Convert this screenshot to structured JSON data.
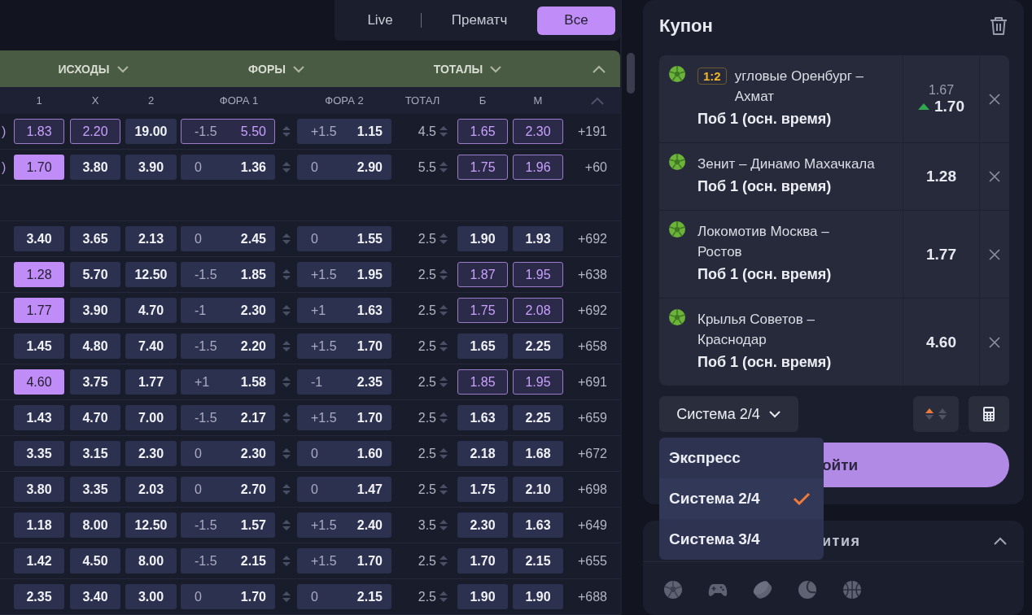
{
  "mode_tabs": [
    {
      "label": "Live",
      "selected": false
    },
    {
      "label": "Прематч",
      "selected": false
    },
    {
      "label": "Все",
      "selected": true
    }
  ],
  "market_groups": [
    "ИСХОДЫ",
    "ФОРЫ",
    "ТОТАЛЫ"
  ],
  "columns": [
    "1",
    "X",
    "2",
    "ФОРА 1",
    "ФОРА 2",
    "ТОТАЛ",
    "Б",
    "М"
  ],
  "row_groups": [
    [
      {
        "tail": ")",
        "cells": [
          {
            "odds": "1.83",
            "selected": false,
            "highlighted": true
          },
          {
            "odds": "2.20",
            "selected": false,
            "highlighted": true
          },
          {
            "odds": "19.00",
            "selected": false,
            "highlighted": false
          }
        ],
        "handicap_1": {
          "line": "-1.5",
          "odds": "5.50",
          "selected": false,
          "highlighted": true
        },
        "handicap_2": {
          "line": "+1.5",
          "odds": "1.15",
          "selected": false,
          "highlighted": false
        },
        "total": "4.5",
        "over": {
          "odds": "1.65",
          "selected": false,
          "highlighted": true
        },
        "under": {
          "odds": "2.30",
          "selected": false,
          "highlighted": true
        },
        "more": "+191"
      },
      {
        "tail": ")",
        "cells": [
          {
            "odds": "1.70",
            "selected": true,
            "highlighted": false
          },
          {
            "odds": "3.80",
            "selected": false,
            "highlighted": false
          },
          {
            "odds": "3.90",
            "selected": false,
            "highlighted": false
          }
        ],
        "handicap_1": {
          "line": "0",
          "odds": "1.36",
          "selected": false,
          "highlighted": false
        },
        "handicap_2": {
          "line": "0",
          "odds": "2.90",
          "selected": false,
          "highlighted": false
        },
        "total": "5.5",
        "over": {
          "odds": "1.75",
          "selected": false,
          "highlighted": true
        },
        "under": {
          "odds": "1.96",
          "selected": false,
          "highlighted": true
        },
        "more": "+60"
      }
    ],
    [
      {
        "cells": [
          {
            "odds": "3.40",
            "selected": false,
            "highlighted": false
          },
          {
            "odds": "3.65",
            "selected": false,
            "highlighted": false
          },
          {
            "odds": "2.13",
            "selected": false,
            "highlighted": false
          }
        ],
        "handicap_1": {
          "line": "0",
          "odds": "2.45",
          "selected": false,
          "highlighted": false
        },
        "handicap_2": {
          "line": "0",
          "odds": "1.55",
          "selected": false,
          "highlighted": false
        },
        "total": "2.5",
        "over": {
          "odds": "1.90",
          "selected": false,
          "highlighted": false
        },
        "under": {
          "odds": "1.93",
          "selected": false,
          "highlighted": false
        },
        "more": "+692"
      },
      {
        "cells": [
          {
            "odds": "1.28",
            "selected": true,
            "highlighted": false
          },
          {
            "odds": "5.70",
            "selected": false,
            "highlighted": false
          },
          {
            "odds": "12.50",
            "selected": false,
            "highlighted": false
          }
        ],
        "handicap_1": {
          "line": "-1.5",
          "odds": "1.85",
          "selected": false,
          "highlighted": false
        },
        "handicap_2": {
          "line": "+1.5",
          "odds": "1.95",
          "selected": false,
          "highlighted": false
        },
        "total": "2.5",
        "over": {
          "odds": "1.87",
          "selected": false,
          "highlighted": true
        },
        "under": {
          "odds": "1.95",
          "selected": false,
          "highlighted": true
        },
        "more": "+638"
      },
      {
        "cells": [
          {
            "odds": "1.77",
            "selected": true,
            "highlighted": false
          },
          {
            "odds": "3.90",
            "selected": false,
            "highlighted": false
          },
          {
            "odds": "4.70",
            "selected": false,
            "highlighted": false
          }
        ],
        "handicap_1": {
          "line": "-1",
          "odds": "2.30",
          "selected": false,
          "highlighted": false
        },
        "handicap_2": {
          "line": "+1",
          "odds": "1.63",
          "selected": false,
          "highlighted": false
        },
        "total": "2.5",
        "over": {
          "odds": "1.75",
          "selected": false,
          "highlighted": true
        },
        "under": {
          "odds": "2.08",
          "selected": false,
          "highlighted": true
        },
        "more": "+692"
      },
      {
        "cells": [
          {
            "odds": "1.45",
            "selected": false,
            "highlighted": false
          },
          {
            "odds": "4.80",
            "selected": false,
            "highlighted": false
          },
          {
            "odds": "7.40",
            "selected": false,
            "highlighted": false
          }
        ],
        "handicap_1": {
          "line": "-1.5",
          "odds": "2.20",
          "selected": false,
          "highlighted": false
        },
        "handicap_2": {
          "line": "+1.5",
          "odds": "1.70",
          "selected": false,
          "highlighted": false
        },
        "total": "2.5",
        "over": {
          "odds": "1.65",
          "selected": false,
          "highlighted": false
        },
        "under": {
          "odds": "2.25",
          "selected": false,
          "highlighted": false
        },
        "more": "+658"
      },
      {
        "cells": [
          {
            "odds": "4.60",
            "selected": true,
            "highlighted": false
          },
          {
            "odds": "3.75",
            "selected": false,
            "highlighted": false
          },
          {
            "odds": "1.77",
            "selected": false,
            "highlighted": false
          }
        ],
        "handicap_1": {
          "line": "+1",
          "odds": "1.58",
          "selected": false,
          "highlighted": false
        },
        "handicap_2": {
          "line": "-1",
          "odds": "2.35",
          "selected": false,
          "highlighted": false
        },
        "total": "2.5",
        "over": {
          "odds": "1.85",
          "selected": false,
          "highlighted": true
        },
        "under": {
          "odds": "1.95",
          "selected": false,
          "highlighted": true
        },
        "more": "+691"
      },
      {
        "cells": [
          {
            "odds": "1.43",
            "selected": false,
            "highlighted": false
          },
          {
            "odds": "4.70",
            "selected": false,
            "highlighted": false
          },
          {
            "odds": "7.00",
            "selected": false,
            "highlighted": false
          }
        ],
        "handicap_1": {
          "line": "-1.5",
          "odds": "2.17",
          "selected": false,
          "highlighted": false
        },
        "handicap_2": {
          "line": "+1.5",
          "odds": "1.70",
          "selected": false,
          "highlighted": false
        },
        "total": "2.5",
        "over": {
          "odds": "1.63",
          "selected": false,
          "highlighted": false
        },
        "under": {
          "odds": "2.25",
          "selected": false,
          "highlighted": false
        },
        "more": "+659"
      },
      {
        "cells": [
          {
            "odds": "3.35",
            "selected": false,
            "highlighted": false
          },
          {
            "odds": "3.15",
            "selected": false,
            "highlighted": false
          },
          {
            "odds": "2.30",
            "selected": false,
            "highlighted": false
          }
        ],
        "handicap_1": {
          "line": "0",
          "odds": "2.30",
          "selected": false,
          "highlighted": false
        },
        "handicap_2": {
          "line": "0",
          "odds": "1.60",
          "selected": false,
          "highlighted": false
        },
        "total": "2.5",
        "over": {
          "odds": "2.18",
          "selected": false,
          "highlighted": false
        },
        "under": {
          "odds": "1.68",
          "selected": false,
          "highlighted": false
        },
        "more": "+672"
      },
      {
        "cells": [
          {
            "odds": "3.80",
            "selected": false,
            "highlighted": false
          },
          {
            "odds": "3.35",
            "selected": false,
            "highlighted": false
          },
          {
            "odds": "2.03",
            "selected": false,
            "highlighted": false
          }
        ],
        "handicap_1": {
          "line": "0",
          "odds": "2.70",
          "selected": false,
          "highlighted": false
        },
        "handicap_2": {
          "line": "0",
          "odds": "1.47",
          "selected": false,
          "highlighted": false
        },
        "total": "2.5",
        "over": {
          "odds": "1.75",
          "selected": false,
          "highlighted": false
        },
        "under": {
          "odds": "2.10",
          "selected": false,
          "highlighted": false
        },
        "more": "+698"
      },
      {
        "cells": [
          {
            "odds": "1.18",
            "selected": false,
            "highlighted": false
          },
          {
            "odds": "8.00",
            "selected": false,
            "highlighted": false
          },
          {
            "odds": "12.50",
            "selected": false,
            "highlighted": false
          }
        ],
        "handicap_1": {
          "line": "-1.5",
          "odds": "1.57",
          "selected": false,
          "highlighted": false
        },
        "handicap_2": {
          "line": "+1.5",
          "odds": "2.40",
          "selected": false,
          "highlighted": false
        },
        "total": "3.5",
        "over": {
          "odds": "2.30",
          "selected": false,
          "highlighted": false
        },
        "under": {
          "odds": "1.63",
          "selected": false,
          "highlighted": false
        },
        "more": "+649"
      },
      {
        "cells": [
          {
            "odds": "1.42",
            "selected": false,
            "highlighted": false
          },
          {
            "odds": "4.50",
            "selected": false,
            "highlighted": false
          },
          {
            "odds": "8.00",
            "selected": false,
            "highlighted": false
          }
        ],
        "handicap_1": {
          "line": "-1.5",
          "odds": "2.15",
          "selected": false,
          "highlighted": false
        },
        "handicap_2": {
          "line": "+1.5",
          "odds": "1.70",
          "selected": false,
          "highlighted": false
        },
        "total": "2.5",
        "over": {
          "odds": "1.70",
          "selected": false,
          "highlighted": false
        },
        "under": {
          "odds": "2.15",
          "selected": false,
          "highlighted": false
        },
        "more": "+655"
      },
      {
        "cells": [
          {
            "odds": "2.35",
            "selected": false,
            "highlighted": false
          },
          {
            "odds": "3.40",
            "selected": false,
            "highlighted": false
          },
          {
            "odds": "3.00",
            "selected": false,
            "highlighted": false
          }
        ],
        "handicap_1": {
          "line": "0",
          "odds": "1.70",
          "selected": false,
          "highlighted": false
        },
        "handicap_2": {
          "line": "0",
          "odds": "2.15",
          "selected": false,
          "highlighted": false
        },
        "total": "2.5",
        "over": {
          "odds": "1.90",
          "selected": false,
          "highlighted": false
        },
        "under": {
          "odds": "1.90",
          "selected": false,
          "highlighted": false
        },
        "more": "+688"
      }
    ]
  ],
  "coupon": {
    "title": "Купон",
    "items": [
      {
        "score": "1:2",
        "event": "угловые Оренбург – Ахмат",
        "market": "Поб 1 (осн. время)",
        "old_odds": "1.67",
        "odds": "1.70",
        "odds_rising": true
      },
      {
        "event": "Зенит – Динамо Махачкала",
        "market": "Поб 1 (осн. время)",
        "odds": "1.28"
      },
      {
        "event": "Локомотив Москва – Ростов",
        "market": "Поб 1 (осн. время)",
        "odds": "1.77"
      },
      {
        "event": "Крылья Советов – Краснодар",
        "market": "Поб 1 (осн. время)",
        "odds": "4.60"
      }
    ],
    "bet_type": "Система 2/4",
    "submit_label": "ойти",
    "bet_type_options": [
      {
        "label": "Экспресс",
        "selected": false
      },
      {
        "label": "Система 2/4",
        "selected": true
      },
      {
        "label": "Система 3/4",
        "selected": false
      }
    ]
  },
  "events_panel": {
    "title": "ития",
    "expanded": true
  }
}
